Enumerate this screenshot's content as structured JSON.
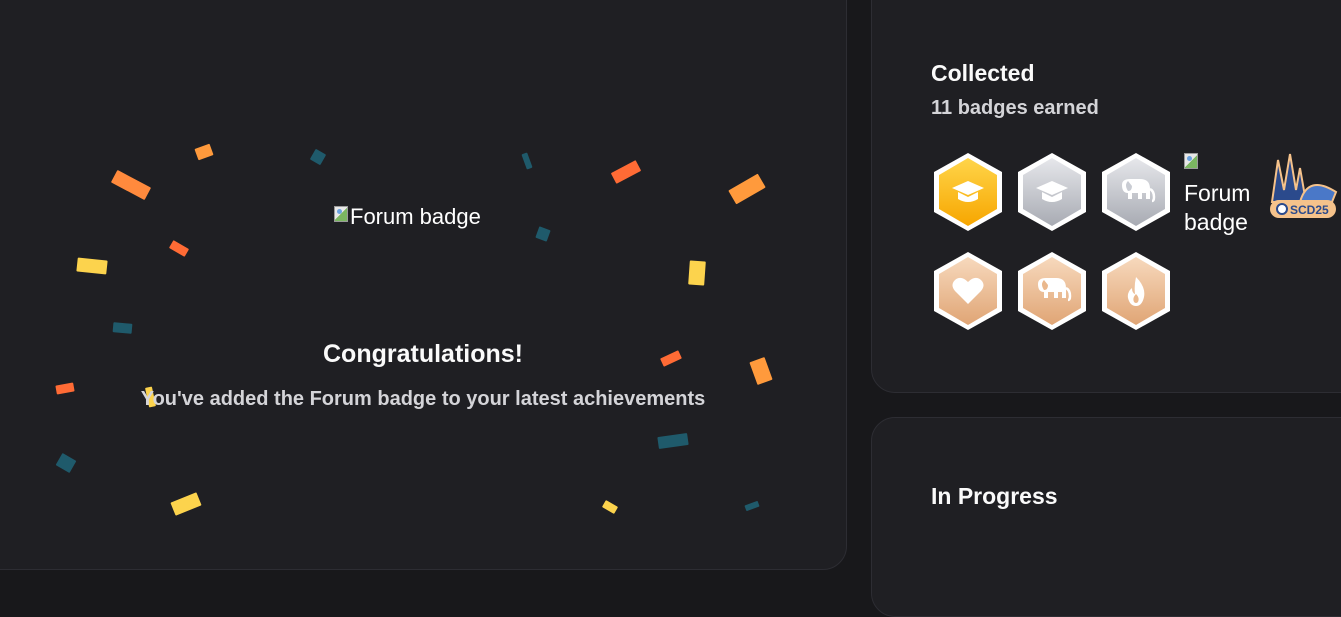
{
  "congrats": {
    "hero_badge_alt": "Forum badge",
    "title": "Congratulations!",
    "message": "You've added the Forum badge to your latest achievements"
  },
  "collected": {
    "title": "Collected",
    "count_text": "11 badges earned",
    "badges": [
      {
        "tier": "gold",
        "icon": "graduation-cap-icon"
      },
      {
        "tier": "silver",
        "icon": "graduation-cap-icon"
      },
      {
        "tier": "silver",
        "icon": "elephant-icon"
      },
      {
        "tier": "broken-image",
        "alt": "Forum badge"
      },
      {
        "tier": "event",
        "icon": "scd25-event-badge",
        "label": "SCD25"
      },
      {
        "tier": "bronze",
        "icon": "heart-icon"
      },
      {
        "tier": "bronze",
        "icon": "elephant-icon"
      },
      {
        "tier": "bronze",
        "icon": "flame-icon"
      }
    ]
  },
  "in_progress": {
    "title": "In Progress"
  },
  "colors": {
    "background": "#18181b",
    "card": "#1f1f23",
    "gold": "#fbbf24",
    "silver": "#d1d5db",
    "bronze": "#f1c7a3"
  }
}
